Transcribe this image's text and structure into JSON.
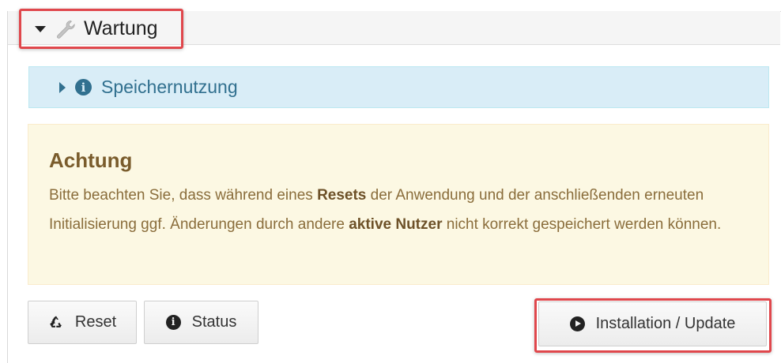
{
  "section": {
    "title": "Wartung",
    "icon": "wrench-icon",
    "expand_icon": "caret-down-icon"
  },
  "info_panel": {
    "title": "Speichernutzung",
    "expand_icon": "caret-right-icon",
    "icon": "info-circle-icon",
    "color": "#31708f",
    "background": "#d9edf7"
  },
  "warning": {
    "title": "Achtung",
    "text_1": "Bitte beachten Sie, dass während eines ",
    "bold_1": "Resets",
    "text_2": " der Anwendung und der anschließenden erneuten Initialisierung ggf. Änderungen durch andere ",
    "bold_2": "aktive Nutzer",
    "text_3": " nicht korrekt gespeichert werden können.",
    "background": "#fcf8e3",
    "color": "#8a6d3b"
  },
  "buttons": {
    "reset": {
      "label": "Reset",
      "icon": "recycle-icon"
    },
    "status": {
      "label": "Status",
      "icon": "info-circle-icon"
    },
    "install": {
      "label": "Installation / Update",
      "icon": "play-circle-icon"
    }
  },
  "highlight_color": "#e0474c"
}
